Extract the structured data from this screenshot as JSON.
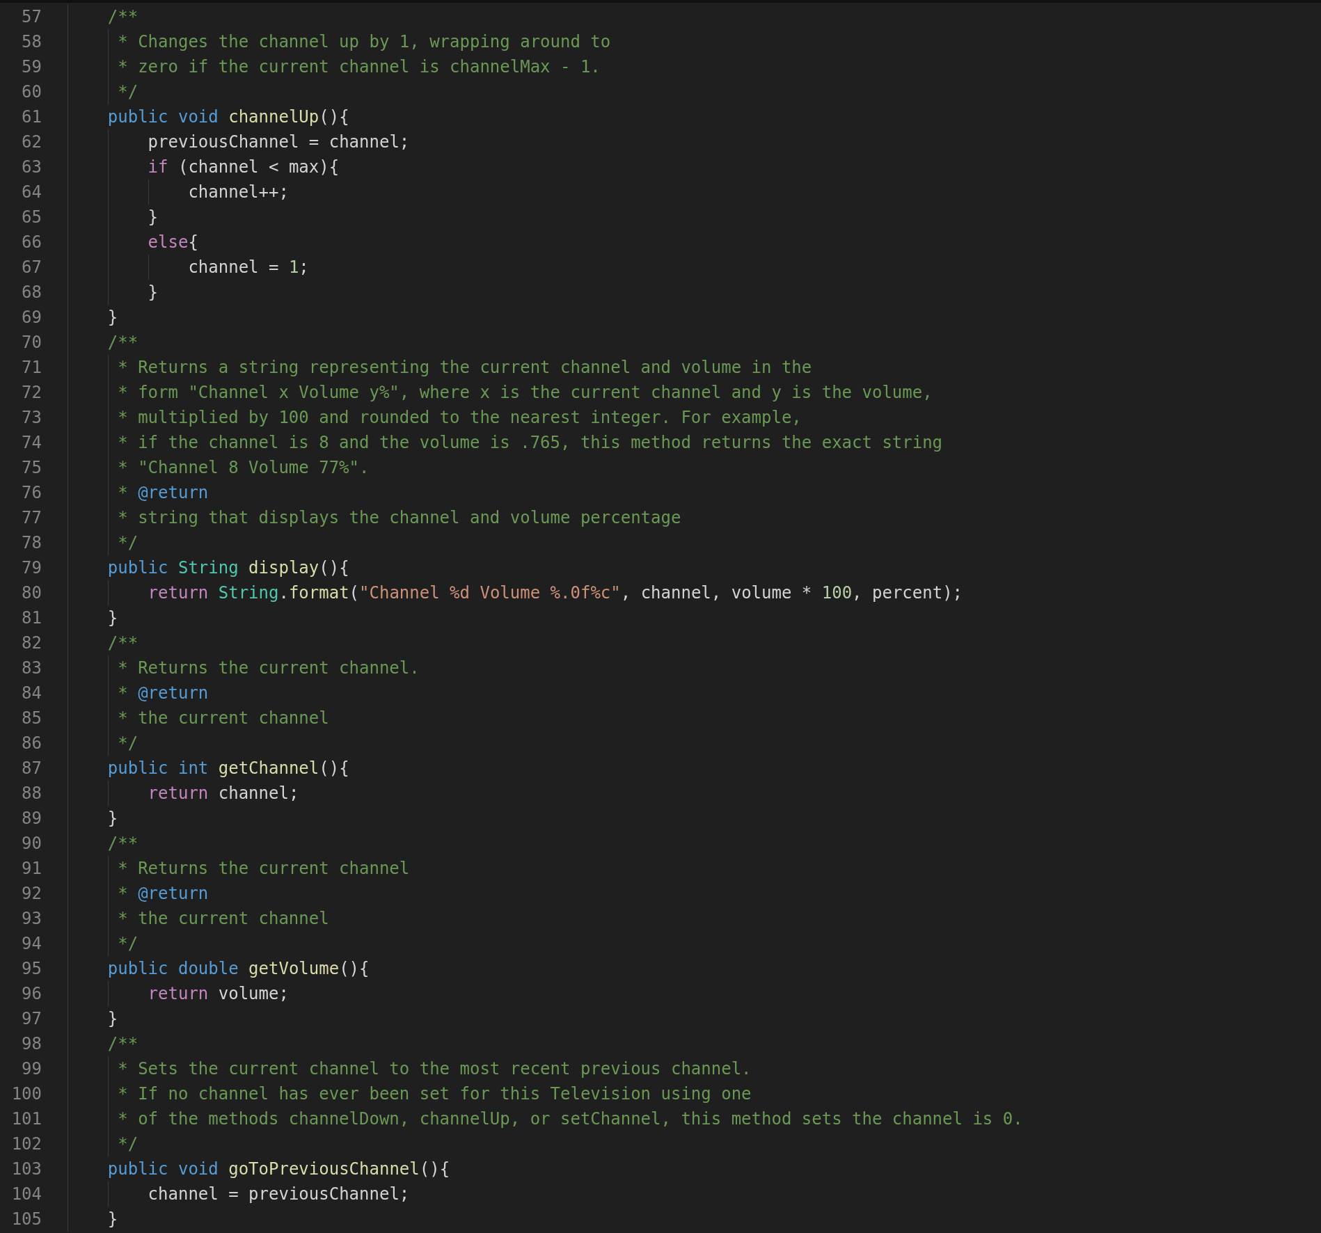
{
  "editor": {
    "lines": [
      {
        "number": "57",
        "kind": "member",
        "tokens": [
          {
            "kind": "comment",
            "text": "/**"
          }
        ]
      },
      {
        "number": "58",
        "kind": "doc",
        "tokens": [
          {
            "kind": "comment",
            "text": "* Changes the channel up by 1, wrapping around to"
          }
        ]
      },
      {
        "number": "59",
        "kind": "doc",
        "tokens": [
          {
            "kind": "comment",
            "text": "* zero if the current channel is channelMax - 1."
          }
        ]
      },
      {
        "number": "60",
        "kind": "doc",
        "tokens": [
          {
            "kind": "comment",
            "text": "*/"
          }
        ]
      },
      {
        "number": "61",
        "kind": "member",
        "tokens": [
          {
            "kind": "keyword",
            "text": "public "
          },
          {
            "kind": "keyword",
            "text": "void "
          },
          {
            "kind": "function",
            "text": "channelUp"
          },
          {
            "kind": "plain",
            "text": "(){"
          }
        ]
      },
      {
        "number": "62",
        "kind": "body",
        "tokens": [
          {
            "kind": "plain",
            "text": "previousChannel = channel;"
          }
        ]
      },
      {
        "number": "63",
        "kind": "body",
        "tokens": [
          {
            "kind": "control",
            "text": "if"
          },
          {
            "kind": "plain",
            "text": " (channel < max){"
          }
        ]
      },
      {
        "number": "64",
        "kind": "nested",
        "tokens": [
          {
            "kind": "plain",
            "text": "channel++;"
          }
        ]
      },
      {
        "number": "65",
        "kind": "body",
        "tokens": [
          {
            "kind": "plain",
            "text": "}"
          }
        ]
      },
      {
        "number": "66",
        "kind": "body",
        "tokens": [
          {
            "kind": "control",
            "text": "else"
          },
          {
            "kind": "plain",
            "text": "{"
          }
        ]
      },
      {
        "number": "67",
        "kind": "nested",
        "tokens": [
          {
            "kind": "plain",
            "text": "channel = "
          },
          {
            "kind": "number",
            "text": "1"
          },
          {
            "kind": "plain",
            "text": ";"
          }
        ]
      },
      {
        "number": "68",
        "kind": "body",
        "tokens": [
          {
            "kind": "plain",
            "text": "}"
          }
        ]
      },
      {
        "number": "69",
        "kind": "member",
        "tokens": [
          {
            "kind": "plain",
            "text": "}"
          }
        ]
      },
      {
        "number": "70",
        "kind": "member",
        "tokens": [
          {
            "kind": "comment",
            "text": "/**"
          }
        ]
      },
      {
        "number": "71",
        "kind": "doc",
        "tokens": [
          {
            "kind": "comment",
            "text": "* Returns a string representing the current channel and volume in the"
          }
        ]
      },
      {
        "number": "72",
        "kind": "doc",
        "tokens": [
          {
            "kind": "comment",
            "text": "* form \"Channel x Volume y%\", where x is the current channel and y is the volume,"
          }
        ]
      },
      {
        "number": "73",
        "kind": "doc",
        "tokens": [
          {
            "kind": "comment",
            "text": "* multiplied by 100 and rounded to the nearest integer. For example,"
          }
        ]
      },
      {
        "number": "74",
        "kind": "doc",
        "tokens": [
          {
            "kind": "comment",
            "text": "* if the channel is 8 and the volume is .765, this method returns the exact string"
          }
        ]
      },
      {
        "number": "75",
        "kind": "doc",
        "tokens": [
          {
            "kind": "comment",
            "text": "* \"Channel 8 Volume 77%\"."
          }
        ]
      },
      {
        "number": "76",
        "kind": "doc",
        "tokens": [
          {
            "kind": "comment",
            "text": "* "
          },
          {
            "kind": "doctag",
            "text": "@return"
          }
        ]
      },
      {
        "number": "77",
        "kind": "doc",
        "tokens": [
          {
            "kind": "comment",
            "text": "* string that displays the channel and volume percentage"
          }
        ]
      },
      {
        "number": "78",
        "kind": "doc",
        "tokens": [
          {
            "kind": "comment",
            "text": "*/"
          }
        ]
      },
      {
        "number": "79",
        "kind": "member",
        "tokens": [
          {
            "kind": "keyword",
            "text": "public "
          },
          {
            "kind": "type",
            "text": "String "
          },
          {
            "kind": "function",
            "text": "display"
          },
          {
            "kind": "plain",
            "text": "(){"
          }
        ]
      },
      {
        "number": "80",
        "kind": "body",
        "tokens": [
          {
            "kind": "control",
            "text": "return "
          },
          {
            "kind": "type",
            "text": "String"
          },
          {
            "kind": "plain",
            "text": "."
          },
          {
            "kind": "function",
            "text": "format"
          },
          {
            "kind": "plain",
            "text": "("
          },
          {
            "kind": "string",
            "text": "\"Channel %d Volume %.0f%c\""
          },
          {
            "kind": "plain",
            "text": ", channel, volume * "
          },
          {
            "kind": "number",
            "text": "100"
          },
          {
            "kind": "plain",
            "text": ", percent);"
          }
        ]
      },
      {
        "number": "81",
        "kind": "member",
        "tokens": [
          {
            "kind": "plain",
            "text": "}"
          }
        ]
      },
      {
        "number": "82",
        "kind": "member",
        "tokens": [
          {
            "kind": "comment",
            "text": "/**"
          }
        ]
      },
      {
        "number": "83",
        "kind": "doc",
        "tokens": [
          {
            "kind": "comment",
            "text": "* Returns the current channel."
          }
        ]
      },
      {
        "number": "84",
        "kind": "doc",
        "tokens": [
          {
            "kind": "comment",
            "text": "* "
          },
          {
            "kind": "doctag",
            "text": "@return"
          }
        ]
      },
      {
        "number": "85",
        "kind": "doc",
        "tokens": [
          {
            "kind": "comment",
            "text": "* the current channel"
          }
        ]
      },
      {
        "number": "86",
        "kind": "doc",
        "tokens": [
          {
            "kind": "comment",
            "text": "*/"
          }
        ]
      },
      {
        "number": "87",
        "kind": "member",
        "tokens": [
          {
            "kind": "keyword",
            "text": "public "
          },
          {
            "kind": "keyword",
            "text": "int "
          },
          {
            "kind": "function",
            "text": "getChannel"
          },
          {
            "kind": "plain",
            "text": "(){"
          }
        ]
      },
      {
        "number": "88",
        "kind": "body",
        "tokens": [
          {
            "kind": "control",
            "text": "return"
          },
          {
            "kind": "plain",
            "text": " channel;"
          }
        ]
      },
      {
        "number": "89",
        "kind": "member",
        "tokens": [
          {
            "kind": "plain",
            "text": "}"
          }
        ]
      },
      {
        "number": "90",
        "kind": "member",
        "tokens": [
          {
            "kind": "comment",
            "text": "/**"
          }
        ]
      },
      {
        "number": "91",
        "kind": "doc",
        "tokens": [
          {
            "kind": "comment",
            "text": "* Returns the current channel"
          }
        ]
      },
      {
        "number": "92",
        "kind": "doc",
        "tokens": [
          {
            "kind": "comment",
            "text": "* "
          },
          {
            "kind": "doctag",
            "text": "@return"
          }
        ]
      },
      {
        "number": "93",
        "kind": "doc",
        "tokens": [
          {
            "kind": "comment",
            "text": "* the current channel"
          }
        ]
      },
      {
        "number": "94",
        "kind": "doc",
        "tokens": [
          {
            "kind": "comment",
            "text": "*/"
          }
        ]
      },
      {
        "number": "95",
        "kind": "member",
        "tokens": [
          {
            "kind": "keyword",
            "text": "public "
          },
          {
            "kind": "keyword",
            "text": "double "
          },
          {
            "kind": "function",
            "text": "getVolume"
          },
          {
            "kind": "plain",
            "text": "(){"
          }
        ]
      },
      {
        "number": "96",
        "kind": "body",
        "tokens": [
          {
            "kind": "control",
            "text": "return"
          },
          {
            "kind": "plain",
            "text": " volume;"
          }
        ]
      },
      {
        "number": "97",
        "kind": "member",
        "tokens": [
          {
            "kind": "plain",
            "text": "}"
          }
        ]
      },
      {
        "number": "98",
        "kind": "member",
        "tokens": [
          {
            "kind": "comment",
            "text": "/**"
          }
        ]
      },
      {
        "number": "99",
        "kind": "doc",
        "tokens": [
          {
            "kind": "comment",
            "text": "* Sets the current channel to the most recent previous channel."
          }
        ]
      },
      {
        "number": "100",
        "kind": "doc",
        "tokens": [
          {
            "kind": "comment",
            "text": "* If no channel has ever been set for this Television using one"
          }
        ]
      },
      {
        "number": "101",
        "kind": "doc",
        "tokens": [
          {
            "kind": "comment",
            "text": "* of the methods channelDown, channelUp, or setChannel, this method sets the channel is 0."
          }
        ]
      },
      {
        "number": "102",
        "kind": "doc",
        "tokens": [
          {
            "kind": "comment",
            "text": "*/"
          }
        ]
      },
      {
        "number": "103",
        "kind": "member",
        "tokens": [
          {
            "kind": "keyword",
            "text": "public "
          },
          {
            "kind": "keyword",
            "text": "void "
          },
          {
            "kind": "function",
            "text": "goToPreviousChannel"
          },
          {
            "kind": "plain",
            "text": "(){"
          }
        ]
      },
      {
        "number": "104",
        "kind": "body",
        "tokens": [
          {
            "kind": "plain",
            "text": "channel = previousChannel;"
          }
        ]
      },
      {
        "number": "105",
        "kind": "member",
        "tokens": [
          {
            "kind": "plain",
            "text": "}"
          }
        ]
      }
    ]
  }
}
